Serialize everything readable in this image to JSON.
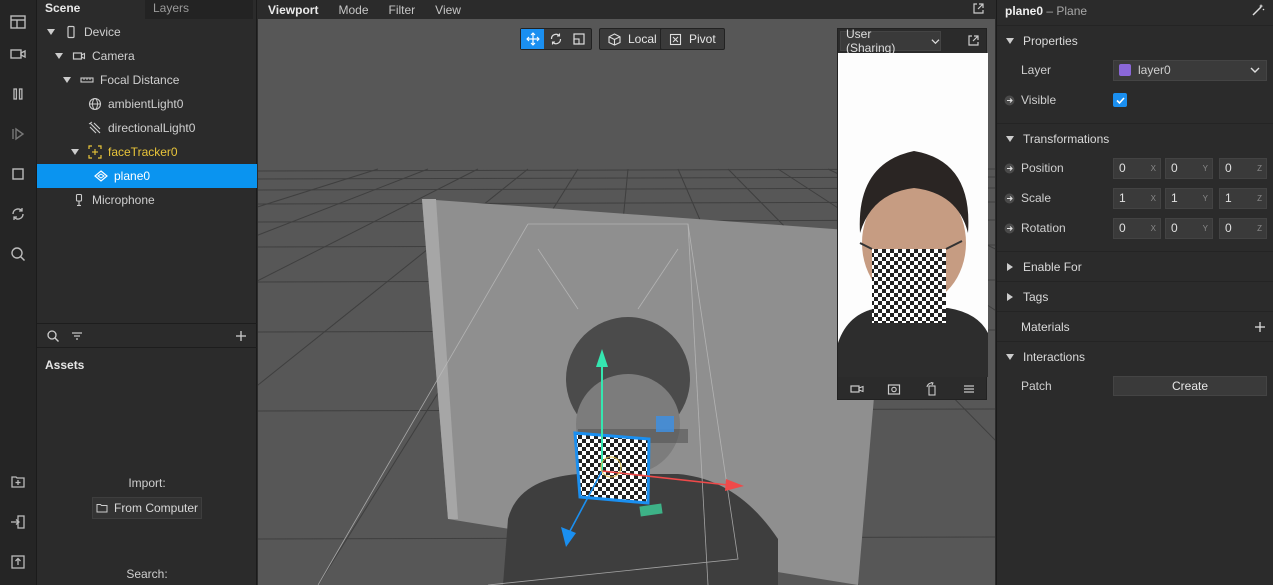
{
  "rail": {
    "icons": [
      "layout-icon",
      "camera-icon",
      "pause-icon",
      "play-icon",
      "stop-icon",
      "reload-icon",
      "search-icon",
      "add-file-icon",
      "import-icon",
      "export-icon"
    ]
  },
  "left_panel": {
    "tabs": [
      {
        "label": "Scene",
        "active": true
      },
      {
        "label": "Layers",
        "active": false
      }
    ],
    "tree": [
      {
        "label": "Device",
        "indent": 0,
        "icon": "device-icon",
        "expanded": true
      },
      {
        "label": "Camera",
        "indent": 1,
        "icon": "camera-icon",
        "expanded": true
      },
      {
        "label": "Focal Distance",
        "indent": 2,
        "icon": "focal-icon",
        "expanded": true
      },
      {
        "label": "ambientLight0",
        "indent": 3,
        "icon": "globe-icon"
      },
      {
        "label": "directionalLight0",
        "indent": 3,
        "icon": "directional-light-icon"
      },
      {
        "label": "faceTracker0",
        "indent": 2,
        "icon": "face-tracker-icon",
        "expanded": true
      },
      {
        "label": "plane0",
        "indent": 3,
        "icon": "plane-icon"
      },
      {
        "label": "Microphone",
        "indent": 1,
        "icon": "microphone-icon"
      }
    ],
    "assets_title": "Assets",
    "import_label": "Import:",
    "from_computer_label": "From Computer",
    "search_label": "Search:"
  },
  "viewport": {
    "menu": [
      "Viewport",
      "Mode",
      "Filter",
      "View"
    ],
    "toolbar": {
      "local_label": "Local",
      "pivot_label": "Pivot"
    },
    "simulator": {
      "device_label": "User (Sharing)"
    }
  },
  "inspector": {
    "object_name": "plane0",
    "object_type": "– Plane",
    "sections": {
      "properties": "Properties",
      "transformations": "Transformations",
      "enable_for": "Enable For",
      "tags": "Tags",
      "materials": "Materials",
      "interactions": "Interactions"
    },
    "layer_label": "Layer",
    "layer_value": "layer0",
    "layer_color": "#8a67d8",
    "visible_label": "Visible",
    "visible_checked": true,
    "position_label": "Position",
    "position": [
      "0",
      "0",
      "0"
    ],
    "scale_label": "Scale",
    "scale": [
      "1",
      "1",
      "1"
    ],
    "rotation_label": "Rotation",
    "rotation": [
      "0",
      "0",
      "0"
    ],
    "axes": [
      "X",
      "Y",
      "Z"
    ],
    "patch_label": "Patch",
    "create_label": "Create"
  },
  "colors": {
    "accent": "#0a94f0",
    "face_tracker": "#e9c53a"
  }
}
